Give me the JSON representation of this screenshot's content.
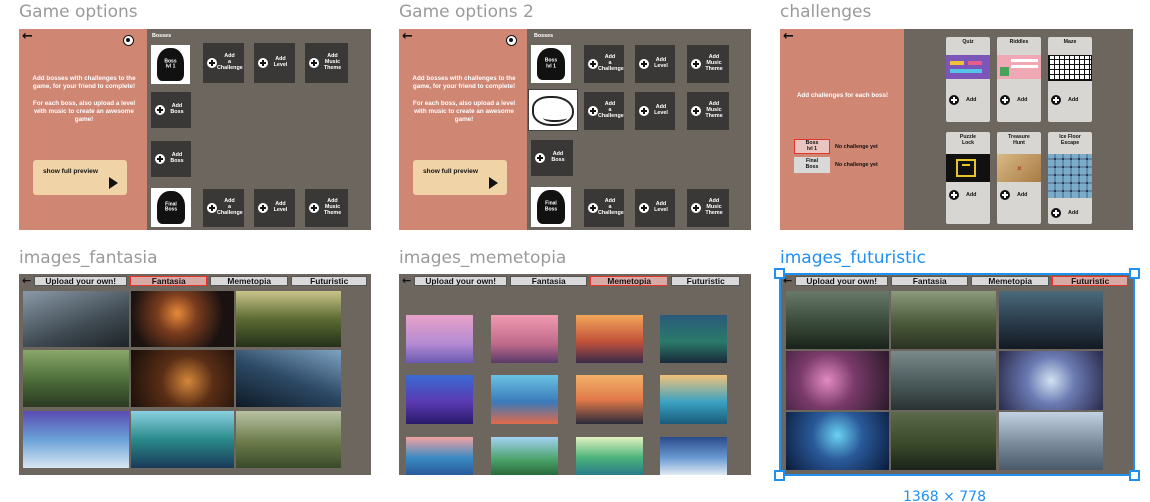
{
  "frames": {
    "game_options": "Game options",
    "game_options_2": "Game options 2",
    "challenges": "challenges",
    "images_fantasia": "images_fantasia",
    "images_memetopia": "images_memetopia",
    "images_futuristic": "images_futuristic"
  },
  "game": {
    "intro": "Add bosses with challenges to the game, for your friend to complete!\n\nFor each boss, also upload a level with music to create an awesome game!",
    "preview_label": "show full preview",
    "bosses_title": "Bosses",
    "boss_lvl1": "Boss\nlvl 1",
    "final_boss": "Final\nBoss",
    "add_challenge": "Add\na\nChallenge",
    "add_level": "Add\nLevel",
    "add_music": "Add\nMusic\nTheme",
    "add_boss": "Add\nBoss"
  },
  "challenges": {
    "intro": "Add challenges for each boss!",
    "boss_lvl1": "Boss\nlvl 1",
    "final_boss": "Final\nBoss",
    "no_challenge": "No challenge yet",
    "add": "Add",
    "cards": [
      "Quiz",
      "Riddles",
      "Maze",
      "Puzzle\nLock",
      "Treasure\nHunt",
      "Ice Floor\nEscape"
    ]
  },
  "tabs": {
    "upload": "Upload your own!",
    "fantasia": "Fantasia",
    "memetopia": "Memetopia",
    "futuristic": "Futuristic"
  },
  "selection": {
    "dimensions": "1368 × 778"
  },
  "colors": {
    "accent": "#1f8ff0",
    "panel": "#cf8673",
    "frame_bg": "#6d665f",
    "active_tab_border": "#e2362b"
  }
}
